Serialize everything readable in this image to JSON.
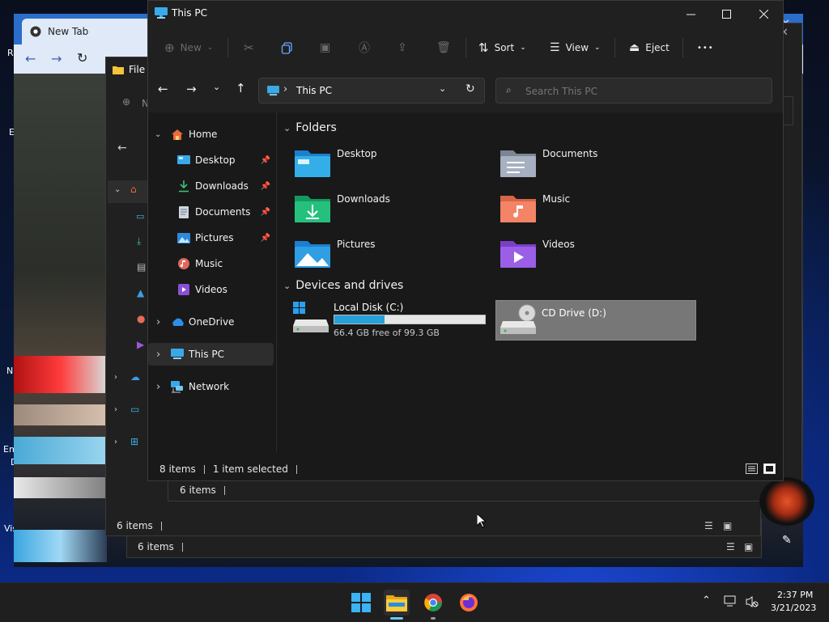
{
  "desktop": {
    "labels": [
      "R",
      "E",
      "N",
      "Em",
      "D",
      "Vis"
    ]
  },
  "browser": {
    "tab_title": "New Tab",
    "close_glyph": "✕"
  },
  "explorer_back1": {
    "title": "File E",
    "new_label": "N",
    "status_items": "6 items"
  },
  "explorer_back2": {
    "status_items": "6 items"
  },
  "explorer_back3": {
    "status_items": "6 items"
  },
  "main": {
    "title": "This PC",
    "commands": {
      "new": "New",
      "sort": "Sort",
      "view": "View",
      "eject": "Eject",
      "more": "•••"
    },
    "address": {
      "crumb_sep": "›",
      "location": "This PC",
      "search_placeholder": "Search This PC"
    },
    "nav": {
      "home": "Home",
      "desktop": "Desktop",
      "downloads": "Downloads",
      "documents": "Documents",
      "pictures": "Pictures",
      "music": "Music",
      "videos": "Videos",
      "onedrive": "OneDrive",
      "thispc": "This PC",
      "network": "Network"
    },
    "sections": {
      "folders": "Folders",
      "devices": "Devices and drives"
    },
    "folders": {
      "desktop": "Desktop",
      "documents": "Documents",
      "downloads": "Downloads",
      "music": "Music",
      "pictures": "Pictures",
      "videos": "Videos"
    },
    "drives": {
      "c_name": "Local Disk (C:)",
      "c_free": "66.4 GB free of 99.3 GB",
      "c_used_fraction": 0.331,
      "d_name": "CD Drive (D:)"
    },
    "status": {
      "items": "8 items",
      "selected": "1 item selected"
    }
  },
  "taskbar": {
    "time": "2:37 PM",
    "date": "3/21/2023"
  },
  "colors": {
    "accent": "#0078d4",
    "drive_bar": "#26a0da",
    "selection": "#777777"
  }
}
